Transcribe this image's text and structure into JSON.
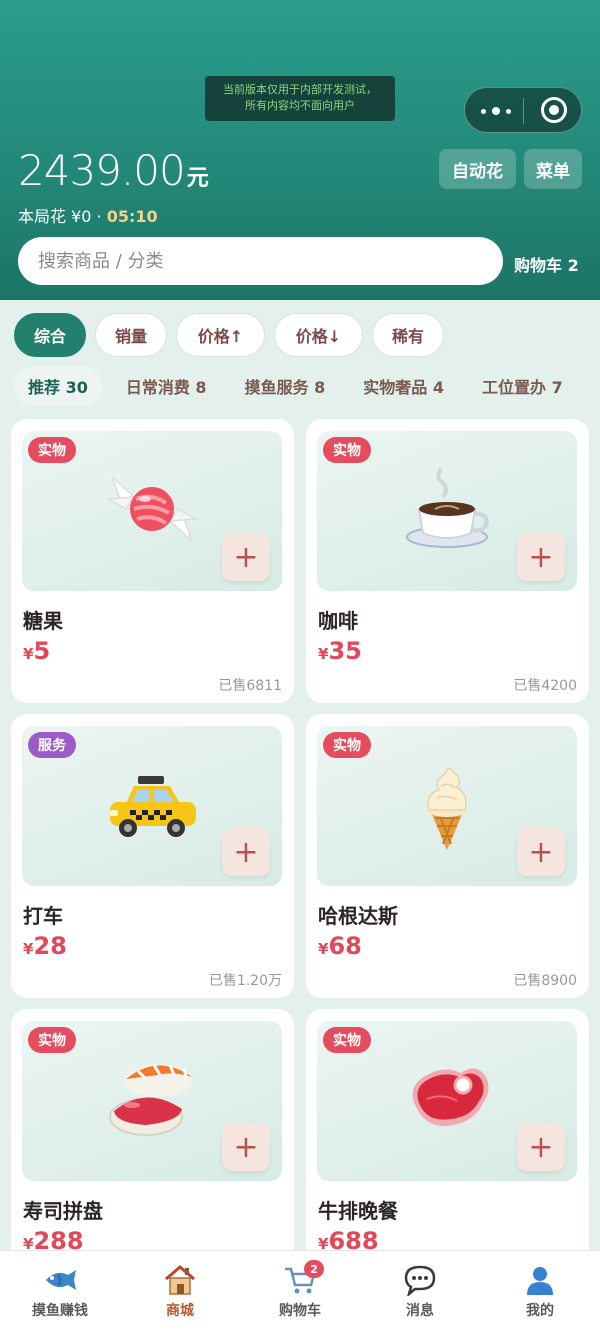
{
  "dev_notice": {
    "line1": "当前版本仅用于内部开发测试，",
    "line2": "所有内容均不面向用户"
  },
  "header": {
    "balance": "2439.00",
    "unit": "元",
    "spent_label": "本局花 ¥0 · ",
    "timer": "05:10",
    "auto_button": "自动花",
    "menu_button": "菜单",
    "search_placeholder": "搜索商品 / 分类",
    "cart_link": "购物车 2"
  },
  "sort_options": [
    "综合",
    "销量",
    "价格↑",
    "价格↓",
    "稀有"
  ],
  "categories": [
    "推荐 30",
    "日常消费 8",
    "摸鱼服务 8",
    "实物奢品 4",
    "工位置办 7"
  ],
  "products": [
    {
      "badge": "实物",
      "badge_type": "physical",
      "icon": "candy-icon",
      "name": "糖果",
      "price_symbol": "¥",
      "price": "5",
      "sold": "已售6811"
    },
    {
      "badge": "实物",
      "badge_type": "physical",
      "icon": "coffee-icon",
      "name": "咖啡",
      "price_symbol": "¥",
      "price": "35",
      "sold": "已售4200"
    },
    {
      "badge": "服务",
      "badge_type": "service",
      "icon": "taxi-icon",
      "name": "打车",
      "price_symbol": "¥",
      "price": "28",
      "sold": "已售1.20万"
    },
    {
      "badge": "实物",
      "badge_type": "physical",
      "icon": "ice-cream-icon",
      "name": "哈根达斯",
      "price_symbol": "¥",
      "price": "68",
      "sold": "已售8900"
    },
    {
      "badge": "实物",
      "badge_type": "physical",
      "icon": "sushi-icon",
      "name": "寿司拼盘",
      "price_symbol": "¥",
      "price": "288",
      "sold": ""
    },
    {
      "badge": "实物",
      "badge_type": "physical",
      "icon": "steak-icon",
      "name": "牛排晚餐",
      "price_symbol": "¥",
      "price": "688",
      "sold": ""
    }
  ],
  "bottom_nav": [
    {
      "label": "摸鱼赚钱",
      "icon": "fish-icon"
    },
    {
      "label": "商城",
      "icon": "house-icon"
    },
    {
      "label": "购物车",
      "icon": "cart-icon",
      "badge": "2"
    },
    {
      "label": "消息",
      "icon": "chat-icon"
    },
    {
      "label": "我的",
      "icon": "user-icon"
    }
  ],
  "colors": {
    "accent": "#23806f",
    "price": "#e2475a",
    "badge_physical": "#e34d5f",
    "badge_service": "#9b5cc8"
  }
}
